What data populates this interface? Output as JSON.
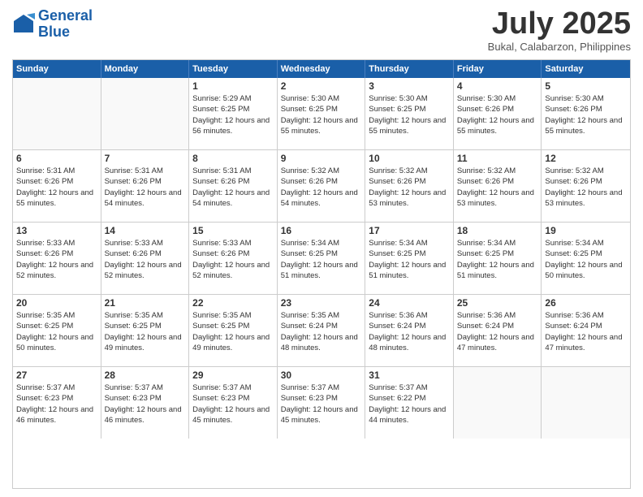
{
  "header": {
    "logo_line1": "General",
    "logo_line2": "Blue",
    "month": "July 2025",
    "location": "Bukal, Calabarzon, Philippines"
  },
  "days_of_week": [
    "Sunday",
    "Monday",
    "Tuesday",
    "Wednesday",
    "Thursday",
    "Friday",
    "Saturday"
  ],
  "weeks": [
    [
      {
        "day": "",
        "empty": true
      },
      {
        "day": "",
        "empty": true
      },
      {
        "day": "1",
        "sunrise": "5:29 AM",
        "sunset": "6:25 PM",
        "daylight": "12 hours and 56 minutes."
      },
      {
        "day": "2",
        "sunrise": "5:30 AM",
        "sunset": "6:25 PM",
        "daylight": "12 hours and 55 minutes."
      },
      {
        "day": "3",
        "sunrise": "5:30 AM",
        "sunset": "6:25 PM",
        "daylight": "12 hours and 55 minutes."
      },
      {
        "day": "4",
        "sunrise": "5:30 AM",
        "sunset": "6:26 PM",
        "daylight": "12 hours and 55 minutes."
      },
      {
        "day": "5",
        "sunrise": "5:30 AM",
        "sunset": "6:26 PM",
        "daylight": "12 hours and 55 minutes."
      }
    ],
    [
      {
        "day": "6",
        "sunrise": "5:31 AM",
        "sunset": "6:26 PM",
        "daylight": "12 hours and 55 minutes."
      },
      {
        "day": "7",
        "sunrise": "5:31 AM",
        "sunset": "6:26 PM",
        "daylight": "12 hours and 54 minutes."
      },
      {
        "day": "8",
        "sunrise": "5:31 AM",
        "sunset": "6:26 PM",
        "daylight": "12 hours and 54 minutes."
      },
      {
        "day": "9",
        "sunrise": "5:32 AM",
        "sunset": "6:26 PM",
        "daylight": "12 hours and 54 minutes."
      },
      {
        "day": "10",
        "sunrise": "5:32 AM",
        "sunset": "6:26 PM",
        "daylight": "12 hours and 53 minutes."
      },
      {
        "day": "11",
        "sunrise": "5:32 AM",
        "sunset": "6:26 PM",
        "daylight": "12 hours and 53 minutes."
      },
      {
        "day": "12",
        "sunrise": "5:32 AM",
        "sunset": "6:26 PM",
        "daylight": "12 hours and 53 minutes."
      }
    ],
    [
      {
        "day": "13",
        "sunrise": "5:33 AM",
        "sunset": "6:26 PM",
        "daylight": "12 hours and 52 minutes."
      },
      {
        "day": "14",
        "sunrise": "5:33 AM",
        "sunset": "6:26 PM",
        "daylight": "12 hours and 52 minutes."
      },
      {
        "day": "15",
        "sunrise": "5:33 AM",
        "sunset": "6:26 PM",
        "daylight": "12 hours and 52 minutes."
      },
      {
        "day": "16",
        "sunrise": "5:34 AM",
        "sunset": "6:25 PM",
        "daylight": "12 hours and 51 minutes."
      },
      {
        "day": "17",
        "sunrise": "5:34 AM",
        "sunset": "6:25 PM",
        "daylight": "12 hours and 51 minutes."
      },
      {
        "day": "18",
        "sunrise": "5:34 AM",
        "sunset": "6:25 PM",
        "daylight": "12 hours and 51 minutes."
      },
      {
        "day": "19",
        "sunrise": "5:34 AM",
        "sunset": "6:25 PM",
        "daylight": "12 hours and 50 minutes."
      }
    ],
    [
      {
        "day": "20",
        "sunrise": "5:35 AM",
        "sunset": "6:25 PM",
        "daylight": "12 hours and 50 minutes."
      },
      {
        "day": "21",
        "sunrise": "5:35 AM",
        "sunset": "6:25 PM",
        "daylight": "12 hours and 49 minutes."
      },
      {
        "day": "22",
        "sunrise": "5:35 AM",
        "sunset": "6:25 PM",
        "daylight": "12 hours and 49 minutes."
      },
      {
        "day": "23",
        "sunrise": "5:35 AM",
        "sunset": "6:24 PM",
        "daylight": "12 hours and 48 minutes."
      },
      {
        "day": "24",
        "sunrise": "5:36 AM",
        "sunset": "6:24 PM",
        "daylight": "12 hours and 48 minutes."
      },
      {
        "day": "25",
        "sunrise": "5:36 AM",
        "sunset": "6:24 PM",
        "daylight": "12 hours and 47 minutes."
      },
      {
        "day": "26",
        "sunrise": "5:36 AM",
        "sunset": "6:24 PM",
        "daylight": "12 hours and 47 minutes."
      }
    ],
    [
      {
        "day": "27",
        "sunrise": "5:37 AM",
        "sunset": "6:23 PM",
        "daylight": "12 hours and 46 minutes."
      },
      {
        "day": "28",
        "sunrise": "5:37 AM",
        "sunset": "6:23 PM",
        "daylight": "12 hours and 46 minutes."
      },
      {
        "day": "29",
        "sunrise": "5:37 AM",
        "sunset": "6:23 PM",
        "daylight": "12 hours and 45 minutes."
      },
      {
        "day": "30",
        "sunrise": "5:37 AM",
        "sunset": "6:23 PM",
        "daylight": "12 hours and 45 minutes."
      },
      {
        "day": "31",
        "sunrise": "5:37 AM",
        "sunset": "6:22 PM",
        "daylight": "12 hours and 44 minutes."
      },
      {
        "day": "",
        "empty": true
      },
      {
        "day": "",
        "empty": true
      }
    ]
  ]
}
